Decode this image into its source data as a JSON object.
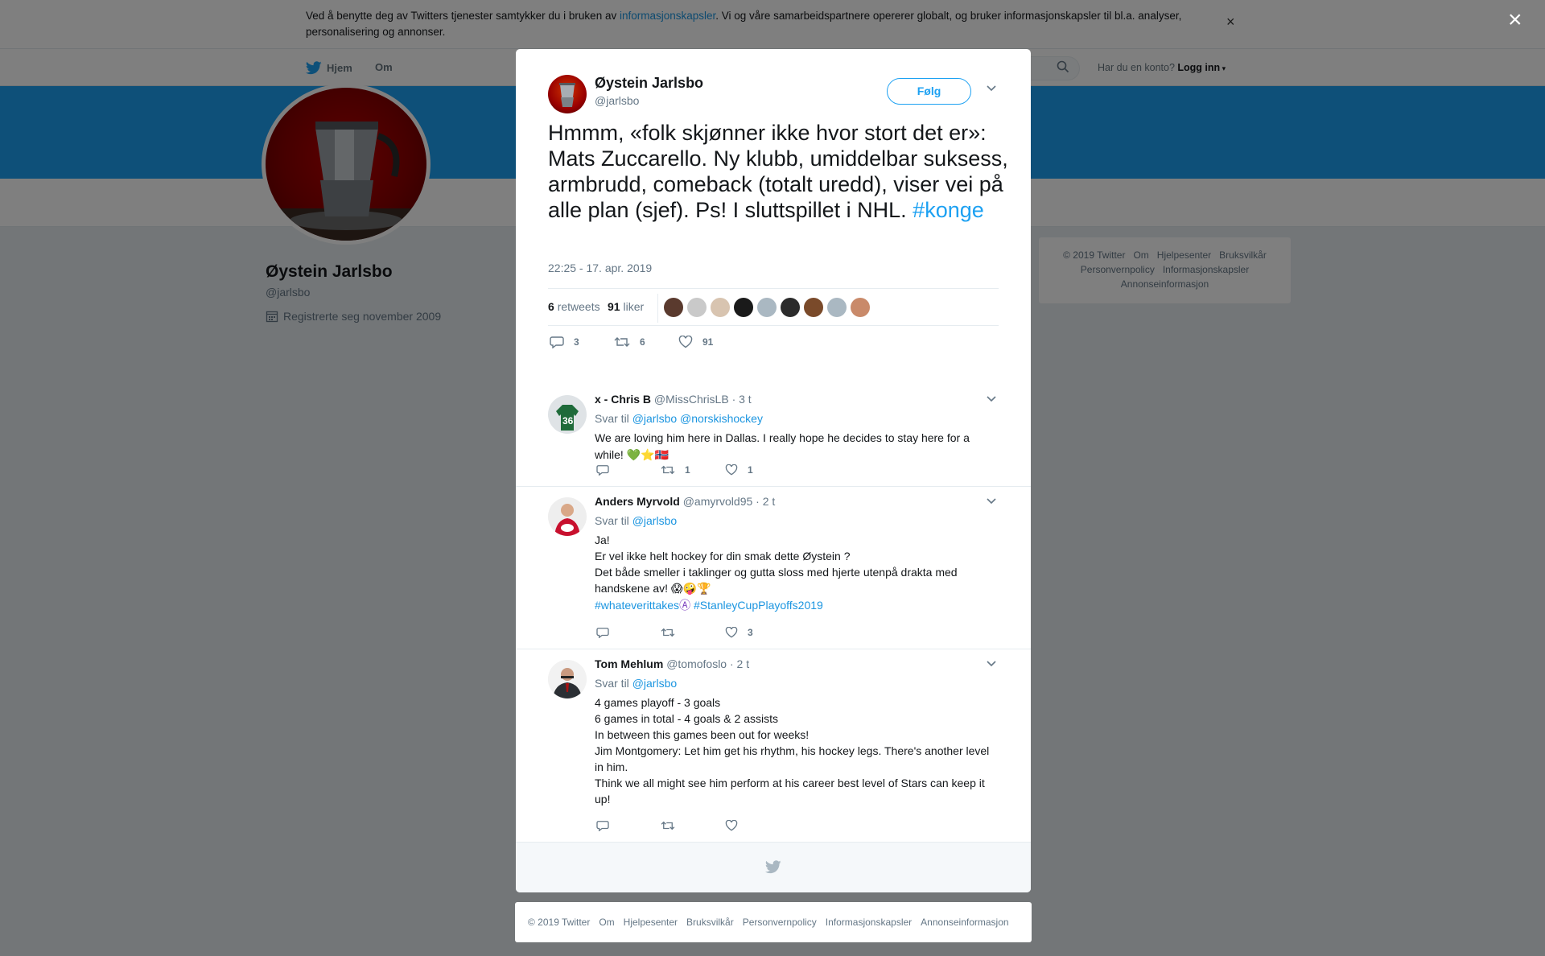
{
  "cookie_banner": {
    "text_before": "Ved å benytte deg av Twitters tjenester samtykker du i bruken av ",
    "link": "informasjonskapsler",
    "text_after": ". Vi og våre samarbeidspartnere opererer globalt, og bruker informasjonskapsler til bl.a. analyser, personalisering og annonser.",
    "close": "×"
  },
  "topnav": {
    "home": "Hjem",
    "about": "Om",
    "have_account": "Har du en konto?",
    "login": "Logg inn"
  },
  "profile": {
    "name": "Øystein Jarlsbo",
    "handle": "@jarlsbo",
    "joined": "Registrerte seg november 2009"
  },
  "side_footer": {
    "line1": [
      "© 2019 Twitter",
      "Om",
      "Hjelpesenter",
      "Bruksvilkår"
    ],
    "line2": [
      "Personvernpolicy",
      "Informasjonskapsler"
    ],
    "line3": [
      "Annonseinformasjon"
    ]
  },
  "overlay_close": "×",
  "tweet": {
    "name": "Øystein Jarlsbo",
    "handle": "@jarlsbo",
    "follow": "Følg",
    "text": "Hmmm, «folk skjønner ikke hvor stort det er»: Mats Zuccarello. Ny klubb, umiddelbar suksess, armbrudd, comeback (totalt uredd), viser vei på alle plan (sjef). Ps! I sluttspillet i NHL. ",
    "hashtag": "#konge",
    "time": "22:25 - 17. apr. 2019",
    "retweets_count": "6",
    "retweets_label": "retweets",
    "likes_count": "91",
    "likes_label": "liker",
    "reply_count": "3",
    "retweet_count": "6",
    "like_count": "91",
    "liker_colors": [
      "#5a3a2e",
      "#c9c9c9",
      "#d8c4b0",
      "#1a1a1a",
      "#aab8c2",
      "#2b2b2b",
      "#7a4a2a",
      "#aab8c2",
      "#c98a6a"
    ]
  },
  "replies": [
    {
      "name": "x - Chris B",
      "handle": "@MissChrisLB",
      "time": "· 3 t",
      "reply_to_label": "Svar til",
      "reply_to": [
        "@jarlsbo",
        "@norskishockey"
      ],
      "body": [
        "We are loving him here in Dallas. I really hope he decides to stay here for a while! 💚⭐🇳🇴"
      ],
      "replies": "",
      "retweets": "1",
      "likes": "1",
      "avatar_color": "#1f6b3a"
    },
    {
      "name": "Anders Myrvold",
      "handle": "@amyrvold95",
      "time": "· 2 t",
      "reply_to_label": "Svar til",
      "reply_to": [
        "@jarlsbo"
      ],
      "body": [
        "Ja!",
        "Er vel ikke helt hockey for din smak dette Øystein ?",
        "Det både smeller i taklinger og gutta sloss med hjerte utenpå drakta med handskene av! 😱🤪🏆"
      ],
      "hashtags": [
        "#whateverittakes",
        "#StanleyCupPlayoffs2019"
      ],
      "replies": "",
      "retweets": "",
      "likes": "3",
      "avatar_color": "#c8102e"
    },
    {
      "name": "Tom Mehlum",
      "handle": "@tomofoslo",
      "time": "· 2 t",
      "reply_to_label": "Svar til",
      "reply_to": [
        "@jarlsbo"
      ],
      "body": [
        "4 games playoff - 3 goals",
        "6 games in total - 4 goals & 2 assists",
        "In between this games been out for weeks!",
        "Jim Montgomery: Let him get his rhythm, his hockey legs. There's another level in him.",
        "Think we all might see him perform at his career best level of Stars can keep it up!"
      ],
      "replies": "",
      "retweets": "",
      "likes": "",
      "avatar_color": "#3a3f45"
    }
  ],
  "bottom_footer": [
    "© 2019 Twitter",
    "Om",
    "Hjelpesenter",
    "Bruksvilkår",
    "Personvernpolicy",
    "Informasjonskapsler",
    "Annonseinformasjon"
  ],
  "colors": {
    "twitter_blue": "#1da1f2",
    "link_blue": "#1b95e0",
    "muted": "#657786",
    "background": "#e6ecf0"
  }
}
